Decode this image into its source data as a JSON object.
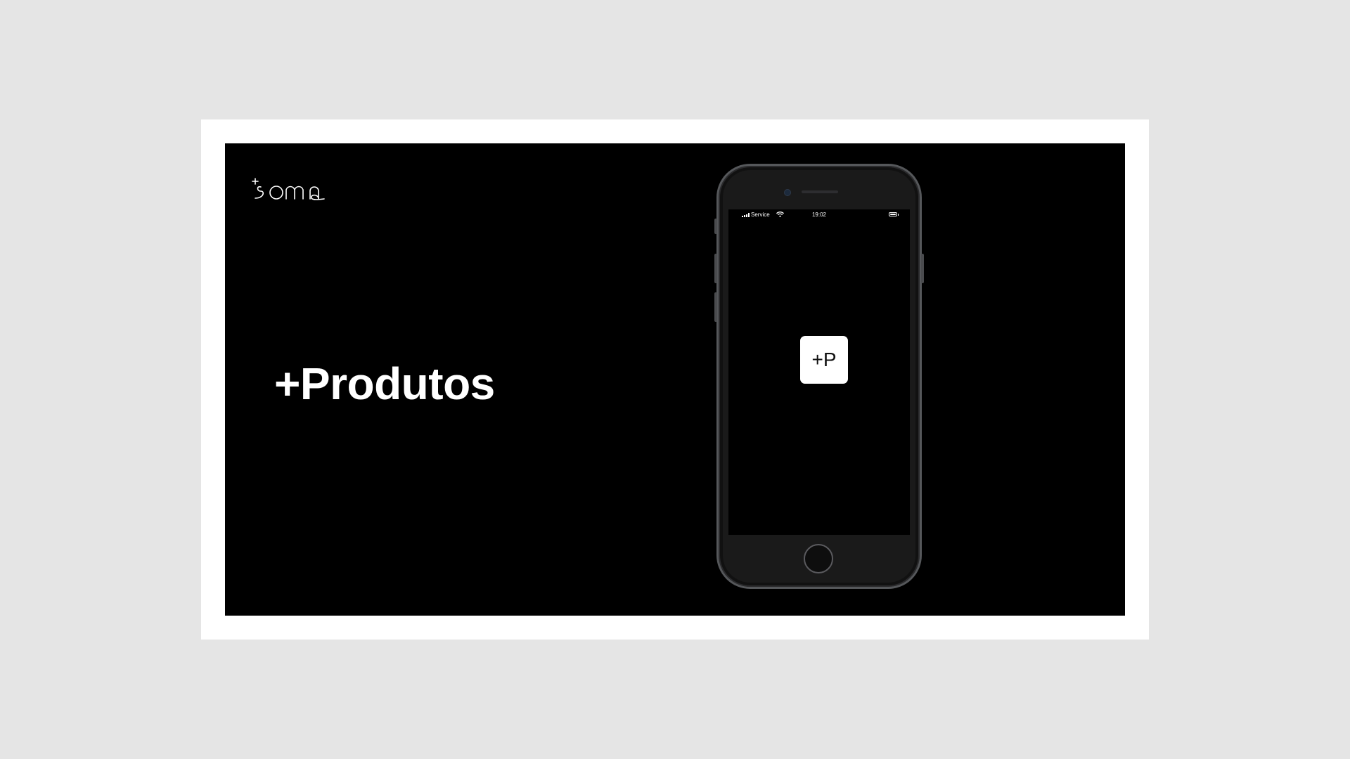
{
  "brand": {
    "logo_name": "soma-logo",
    "logo_text": "+soma"
  },
  "slide": {
    "headline": "+Produtos"
  },
  "phone": {
    "status_bar": {
      "carrier": "Service",
      "time": "19:02"
    },
    "app_icon_label": "+P"
  },
  "colors": {
    "page_background": "#e5e5e5",
    "frame": "#ffffff",
    "slide_background": "#000000",
    "text": "#ffffff",
    "phone_frame": "#55575a"
  }
}
